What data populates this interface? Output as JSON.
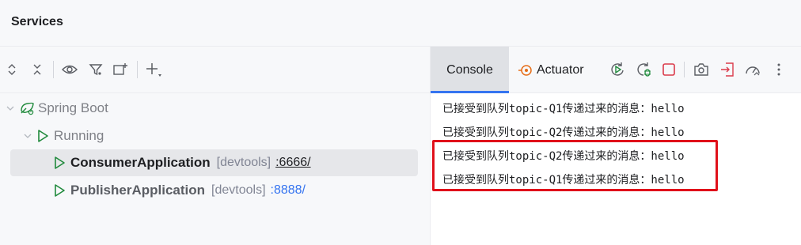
{
  "panel": {
    "title": "Services"
  },
  "toolbar": {
    "icons": [
      "expand-all-icon",
      "collapse-all-icon",
      "eye-icon",
      "filter-icon",
      "new-group-icon",
      "add-service-icon"
    ]
  },
  "tree": {
    "root": {
      "label": "Spring Boot"
    },
    "group": {
      "label": "Running"
    },
    "items": [
      {
        "name": "ConsumerApplication",
        "tag": "[devtools]",
        "port": ":6666/"
      },
      {
        "name": "PublisherApplication",
        "tag": "[devtools]",
        "port": ":8888/"
      }
    ]
  },
  "tabs": {
    "console": "Console",
    "actuator": "Actuator"
  },
  "console": {
    "lines": [
      "已接受到队列topic-Q1传递过来的消息：hello",
      "已接受到队列topic-Q2传递过来的消息：hello",
      "已接受到队列topic-Q2传递过来的消息：hello",
      "已接受到队列topic-Q1传递过来的消息：hello"
    ]
  },
  "colors": {
    "accent": "#3574f0",
    "run_green": "#208a3c",
    "stop_red": "#db3b4b",
    "highlight_red": "#e0101a",
    "actuator_orange": "#e66d17"
  }
}
